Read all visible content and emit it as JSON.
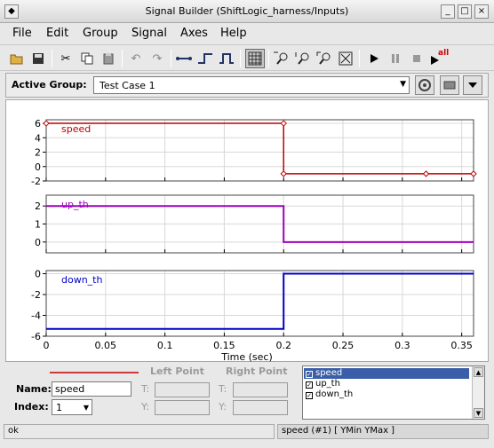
{
  "window": {
    "title": "Signal Builder (ShiftLogic_harness/Inputs)"
  },
  "menu": [
    "File",
    "Edit",
    "Group",
    "Signal",
    "Axes",
    "Help"
  ],
  "toolbar": {
    "icons": [
      "open-icon",
      "save-icon",
      "cut-icon",
      "copy-icon",
      "paste-icon",
      "undo-icon",
      "redo-icon",
      "line-icon",
      "step-icon",
      "pulse-icon",
      "grid-icon",
      "zoom-x-icon",
      "zoom-y-icon",
      "zoom-xy-icon",
      "fit-icon",
      "play-icon",
      "pause-icon",
      "stop-icon",
      "play-all-icon"
    ],
    "run_all_badge": "all"
  },
  "group": {
    "label": "Active Group:",
    "selected": "Test Case 1"
  },
  "axes": {
    "xlabel": "Time (sec)",
    "xticks": [
      "0",
      "0.05",
      "0.1",
      "0.15",
      "0.2",
      "0.25",
      "0.3",
      "0.35"
    ]
  },
  "chart_data": [
    {
      "type": "line",
      "series": [
        {
          "name": "speed",
          "color": "#c00000",
          "x": [
            0,
            0.2,
            0.2,
            0.32,
            0.36
          ],
          "y": [
            6,
            6,
            -1,
            -1,
            -1
          ]
        }
      ],
      "ylim": [
        -2,
        6.5
      ],
      "yticks": [
        "6",
        "4",
        "2",
        "0",
        "-2"
      ],
      "xlim": [
        0,
        0.36
      ]
    },
    {
      "type": "line",
      "series": [
        {
          "name": "up_th",
          "color": "#a000c0",
          "x": [
            0,
            0.2,
            0.2,
            0.36
          ],
          "y": [
            2,
            2,
            0,
            0
          ]
        }
      ],
      "ylim": [
        -0.6,
        2.6
      ],
      "yticks": [
        "2",
        "1",
        "0"
      ],
      "xlim": [
        0,
        0.36
      ]
    },
    {
      "type": "line",
      "series": [
        {
          "name": "down_th",
          "color": "#0000c8",
          "x": [
            0,
            0.2,
            0.2,
            0.36
          ],
          "y": [
            -5.3,
            -5.3,
            0,
            0
          ]
        }
      ],
      "ylim": [
        -6,
        0.3
      ],
      "yticks": [
        "0",
        "-2",
        "-4",
        "-6"
      ],
      "xlim": [
        0,
        0.36
      ]
    }
  ],
  "editor": {
    "left_point": "Left Point",
    "right_point": "Right Point",
    "name_label": "Name:",
    "name_value": "speed",
    "index_label": "Index:",
    "index_value": "1",
    "t_label": "T:",
    "y_label": "Y:"
  },
  "signal_list": [
    {
      "name": "speed",
      "checked": true,
      "selected": true
    },
    {
      "name": "up_th",
      "checked": true,
      "selected": false
    },
    {
      "name": "down_th",
      "checked": true,
      "selected": false
    }
  ],
  "status": {
    "left": "ok",
    "right": "speed (#1)  [ YMin YMax ]"
  }
}
